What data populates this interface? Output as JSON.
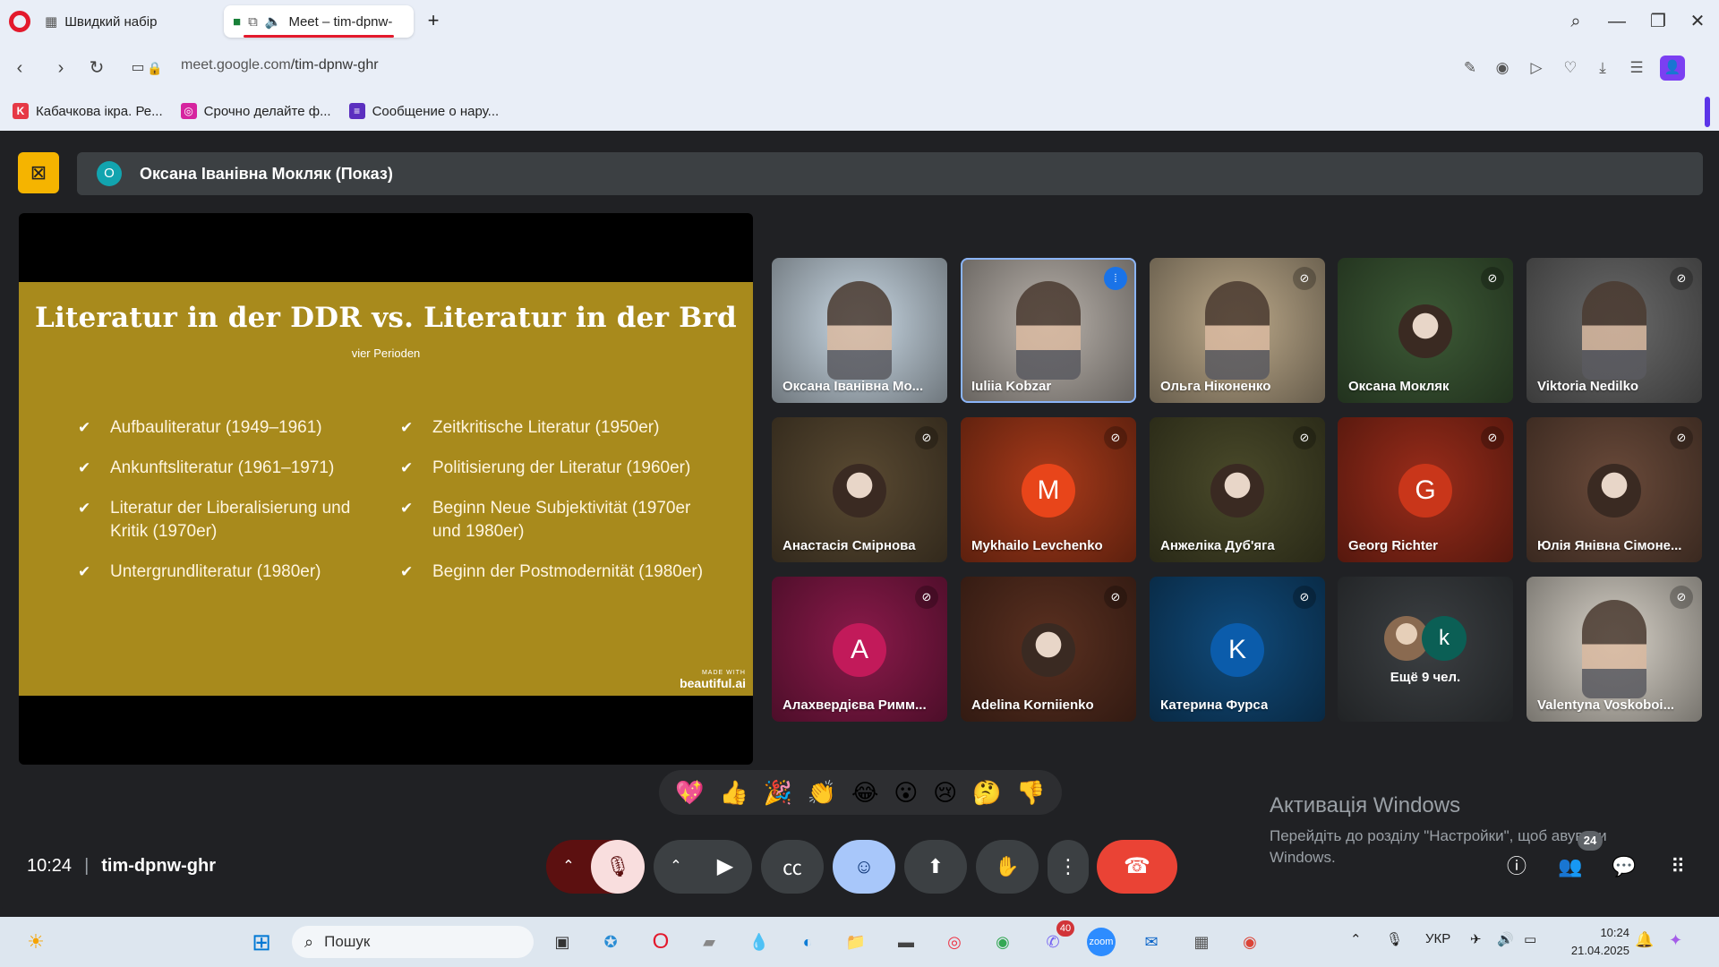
{
  "browser": {
    "tabs": [
      {
        "label": "Швидкий набір",
        "icon": "speed-dial-icon"
      },
      {
        "label": "Meet – tim-dpnw-",
        "icon": "google-meet-icon"
      }
    ],
    "url_domain": "meet.google.com",
    "url_path": "/tim-dpnw-ghr",
    "bookmarks": [
      {
        "label": "Кабачкова ікра. Ре...",
        "color": "#e63946"
      },
      {
        "label": "Срочно делайте ф...",
        "color": "#d6249f"
      },
      {
        "label": "Сообщение о нару...",
        "color": "#5b2fbf"
      }
    ]
  },
  "meet": {
    "presenter_initial": "О",
    "presenter_title": "Оксана Іванівна Мокляк (Показ)",
    "slide": {
      "title": "Literatur in der DDR vs. Literatur in der Brd",
      "subtitle": "vier Perioden",
      "left_items": [
        "Aufbauliteratur (1949–1961)",
        "Ankunftsliteratur (1961–1971)",
        "Literatur der Liberalisierung und Kritik (1970er)",
        "Untergrundliteratur (1980er)"
      ],
      "right_items": [
        "Zeitkritische Literatur (1950er)",
        "Politisierung der Literatur (1960er)",
        "Beginn Neue Subjektivität (1970er und 1980er)",
        "Beginn der Postmodernität (1980er)"
      ],
      "brand_small": "MADE WITH",
      "brand": "beautiful.ai"
    },
    "participants": [
      {
        "name": "Оксана Іванівна Мо...",
        "kind": "video",
        "bg": "#c9d8e4"
      },
      {
        "name": "Iuliia Kobzar",
        "kind": "video",
        "bg": "#b9b2ab",
        "speaking": true
      },
      {
        "name": "Ольга Ніконенко",
        "kind": "video",
        "bg": "#bca98a"
      },
      {
        "name": "Оксана Мокляк",
        "kind": "photo",
        "bg": "#3d5a36"
      },
      {
        "name": "Viktoria Nedilko",
        "kind": "video",
        "bg": "#6b6b6b"
      },
      {
        "name": "Анастасія Смірнова",
        "kind": "photo",
        "bg": "#5a4a32"
      },
      {
        "name": "Mykhailo Levchenko",
        "kind": "letter",
        "letter": "M",
        "bg": "#a83a1a",
        "circle": "#e8451a"
      },
      {
        "name": "Анжеліка Дуб'яга",
        "kind": "photo",
        "bg": "#4a4a2a"
      },
      {
        "name": "Georg Richter",
        "kind": "letter",
        "letter": "G",
        "bg": "#9a2c1a",
        "circle": "#c9361a"
      },
      {
        "name": "Юлія Янівна Сімоне...",
        "kind": "photo",
        "bg": "#6a4a3a"
      },
      {
        "name": "Алахвердієва Римм...",
        "kind": "letter",
        "letter": "A",
        "bg": "#8a1a4a",
        "circle": "#c21a5a"
      },
      {
        "name": "Adelina Korniienko",
        "kind": "photo",
        "bg": "#5a3020"
      },
      {
        "name": "Катерина Фурса",
        "kind": "letter",
        "letter": "K",
        "bg": "#104a7a",
        "circle": "#0b5cab"
      },
      {
        "name": "Ещё 9 чел.",
        "kind": "more",
        "letter": "k",
        "bg": "#3c4043"
      },
      {
        "name": "Valentyna Voskoboi...",
        "kind": "video",
        "bg": "#d8d2c8"
      }
    ],
    "reactions": [
      "💖",
      "👍",
      "🎉",
      "👏",
      "😂",
      "😮",
      "😢",
      "🤔",
      "👎"
    ],
    "time": "10:24",
    "meeting_code": "tim-dpnw-ghr",
    "people_count": "24"
  },
  "windows_activation": {
    "title": "Активація Windows",
    "text_line1": "Перейдіть до розділу \"Настройки\", щоб а",
    "text_line1_end": "вувати",
    "text_line2": "Windows."
  },
  "taskbar": {
    "search_placeholder": "Пошук",
    "viber_badge": "40",
    "lang": "УКР",
    "time": "10:24",
    "date": "21.04.2025"
  }
}
